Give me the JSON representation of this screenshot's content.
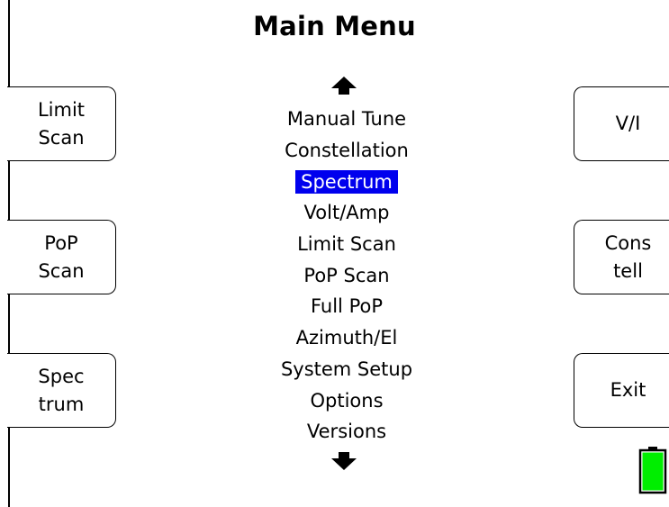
{
  "title": "Main Menu",
  "left_softkeys": [
    {
      "line1": "Limit",
      "line2": "Scan"
    },
    {
      "line1": "PoP",
      "line2": "Scan"
    },
    {
      "line1": "Spec",
      "line2": "trum"
    }
  ],
  "right_softkeys": [
    {
      "line1": "V/I",
      "line2": ""
    },
    {
      "line1": "Cons",
      "line2": "tell"
    },
    {
      "line1": "Exit",
      "line2": ""
    }
  ],
  "menu": {
    "items": [
      "Manual Tune",
      "Constellation",
      "Spectrum",
      "Volt/Amp",
      "Limit Scan",
      "PoP Scan",
      "Full PoP",
      "Azimuth/El",
      "System Setup",
      "Options",
      "Versions"
    ],
    "selected": "Spectrum",
    "selection_color": "#0000ee"
  },
  "icons": {
    "scroll_up": "arrow-up-icon",
    "scroll_down": "arrow-down-icon",
    "battery": "battery-icon"
  },
  "battery": {
    "level": 1.0,
    "color": "#00ee00"
  }
}
